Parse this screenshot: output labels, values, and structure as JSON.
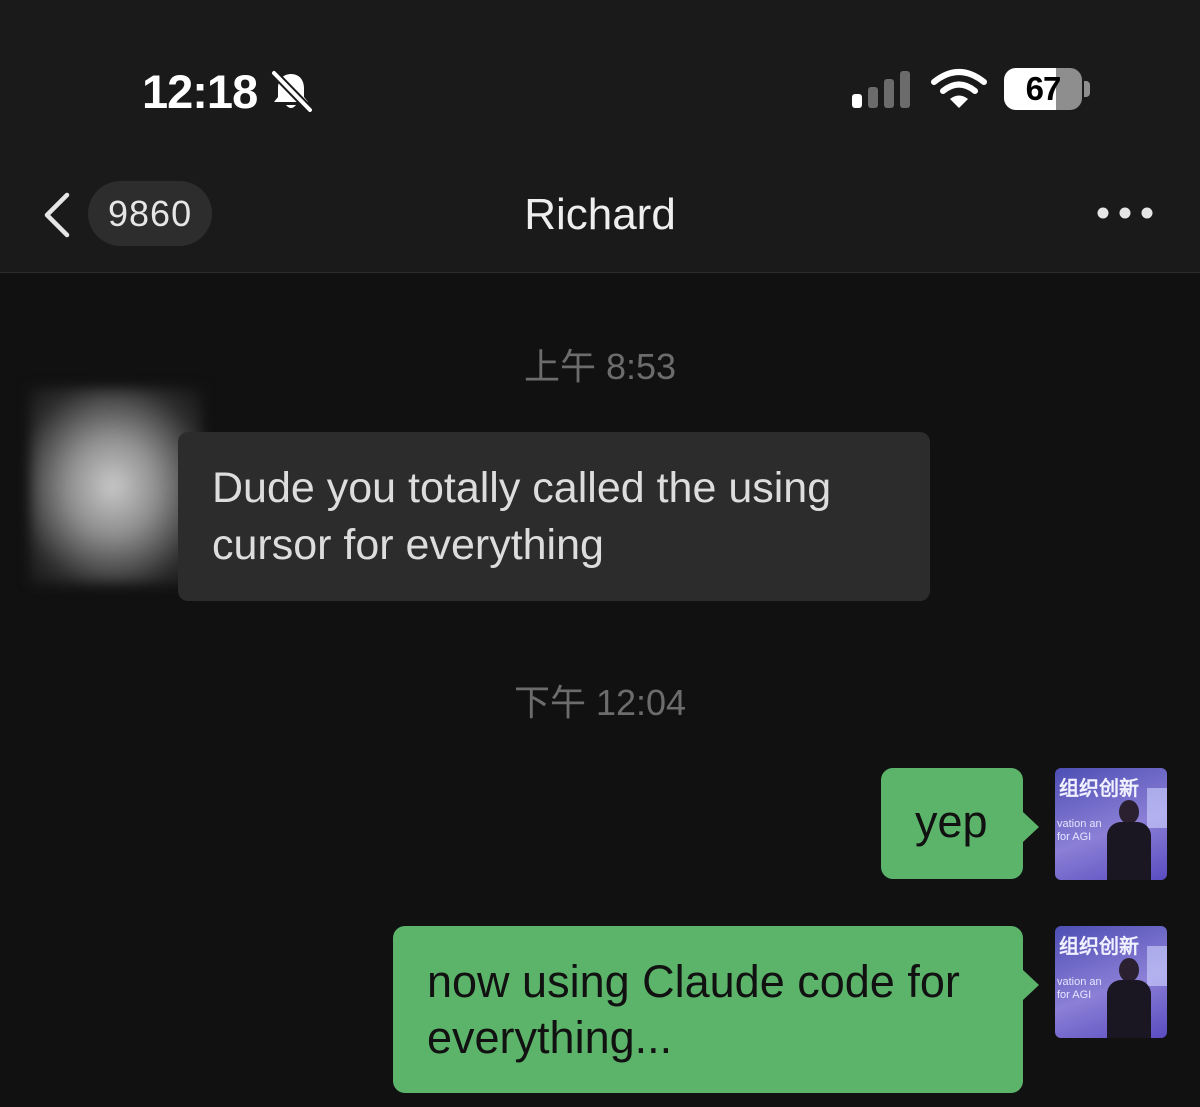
{
  "status_bar": {
    "time": "12:18",
    "silent_icon": "bell-slash-icon",
    "signal_icon": "cellular-signal-icon",
    "signal_bars_filled": 1,
    "wifi_icon": "wifi-icon",
    "battery_percent": "67",
    "battery_level": 0.67
  },
  "nav": {
    "back_icon": "chevron-left-icon",
    "unread_count": "9860",
    "title": "Richard",
    "more_icon": "ellipsis-icon"
  },
  "messages": [
    {
      "type": "timestamp",
      "text": "上午 8:53"
    },
    {
      "type": "incoming",
      "sender": "Richard",
      "text": "Dude you totally called the using cursor for everything"
    },
    {
      "type": "timestamp",
      "text": "下午 12:04"
    },
    {
      "type": "outgoing",
      "text": "yep"
    },
    {
      "type": "outgoing",
      "text": "now using Claude code for everything..."
    }
  ],
  "self_avatar": {
    "sign_text": "组织创新",
    "sub_text_1": "vation an",
    "sub_text_2": "for AGI"
  },
  "colors": {
    "background": "#111111",
    "header": "#1a1a1a",
    "incoming_bubble": "#2c2c2c",
    "outgoing_bubble": "#5cb46a",
    "timestamp": "#6c6c6c"
  }
}
